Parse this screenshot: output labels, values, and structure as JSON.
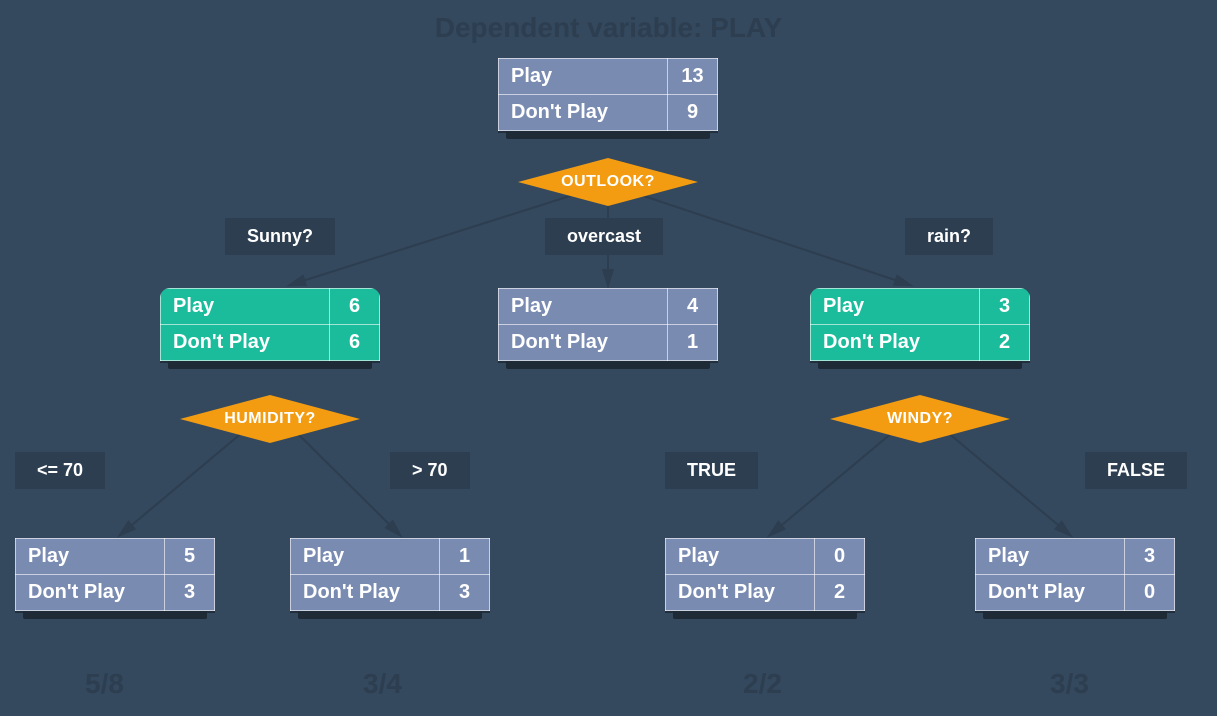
{
  "title": "Dependent variable: PLAY",
  "root": {
    "play_label": "Play",
    "play_val": "13",
    "dont_label": "Don't Play",
    "dont_val": "9"
  },
  "split_root": "OUTLOOK?",
  "branches": {
    "sunny": "Sunny?",
    "overcast": "overcast",
    "rain": "rain?"
  },
  "sunny_node": {
    "play_label": "Play",
    "play_val": "6",
    "dont_label": "Don't Play",
    "dont_val": "6"
  },
  "overcast_node": {
    "play_label": "Play",
    "play_val": "4",
    "dont_label": "Don't Play",
    "dont_val": "1"
  },
  "rain_node": {
    "play_label": "Play",
    "play_val": "3",
    "dont_label": "Don't Play",
    "dont_val": "2"
  },
  "split_sunny": "HUMIDITY?",
  "split_rain": "WINDY?",
  "hum_branches": {
    "le70": "<= 70",
    "gt70": "> 70"
  },
  "wind_branches": {
    "true": "TRUE",
    "false": "FALSE"
  },
  "leaf_le70": {
    "play_label": "Play",
    "play_val": "5",
    "dont_label": "Don't Play",
    "dont_val": "3"
  },
  "leaf_gt70": {
    "play_label": "Play",
    "play_val": "1",
    "dont_label": "Don't Play",
    "dont_val": "3"
  },
  "leaf_true": {
    "play_label": "Play",
    "play_val": "0",
    "dont_label": "Don't Play",
    "dont_val": "2"
  },
  "leaf_false": {
    "play_label": "Play",
    "play_val": "3",
    "dont_label": "Don't Play",
    "dont_val": "0"
  },
  "ratios": {
    "r1": "5/8",
    "r2": "3/4",
    "r3": "2/2",
    "r4": "3/3"
  },
  "chart_data": {
    "type": "tree",
    "title": "Dependent variable: PLAY",
    "root": {
      "counts": {
        "Play": 13,
        "Don't Play": 9
      },
      "split_on": "OUTLOOK",
      "children": [
        {
          "branch": "Sunny",
          "counts": {
            "Play": 6,
            "Don't Play": 6
          },
          "split_on": "HUMIDITY",
          "children": [
            {
              "branch": "<= 70",
              "counts": {
                "Play": 5,
                "Don't Play": 3
              },
              "ratio": "5/8"
            },
            {
              "branch": "> 70",
              "counts": {
                "Play": 1,
                "Don't Play": 3
              },
              "ratio": "3/4"
            }
          ]
        },
        {
          "branch": "overcast",
          "counts": {
            "Play": 4,
            "Don't Play": 1
          }
        },
        {
          "branch": "rain",
          "counts": {
            "Play": 3,
            "Don't Play": 2
          },
          "split_on": "WINDY",
          "children": [
            {
              "branch": "TRUE",
              "counts": {
                "Play": 0,
                "Don't Play": 2
              },
              "ratio": "2/2"
            },
            {
              "branch": "FALSE",
              "counts": {
                "Play": 3,
                "Don't Play": 0
              },
              "ratio": "3/3"
            }
          ]
        }
      ]
    }
  }
}
